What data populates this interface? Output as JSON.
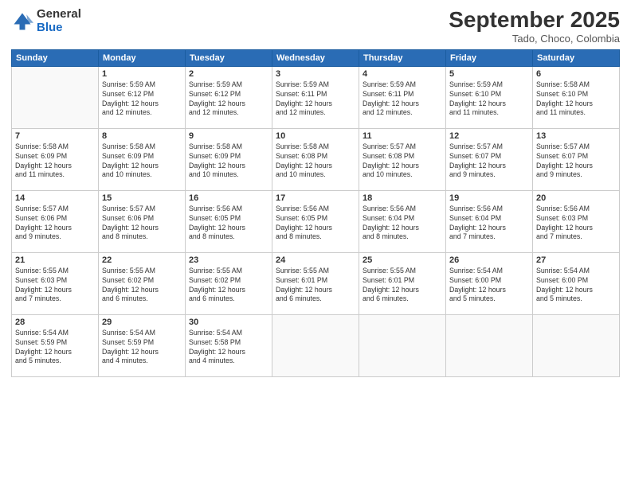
{
  "header": {
    "logo_general": "General",
    "logo_blue": "Blue",
    "month_title": "September 2025",
    "location": "Tado, Choco, Colombia"
  },
  "days_of_week": [
    "Sunday",
    "Monday",
    "Tuesday",
    "Wednesday",
    "Thursday",
    "Friday",
    "Saturday"
  ],
  "weeks": [
    [
      {
        "day": "",
        "info": ""
      },
      {
        "day": "1",
        "info": "Sunrise: 5:59 AM\nSunset: 6:12 PM\nDaylight: 12 hours\nand 12 minutes."
      },
      {
        "day": "2",
        "info": "Sunrise: 5:59 AM\nSunset: 6:12 PM\nDaylight: 12 hours\nand 12 minutes."
      },
      {
        "day": "3",
        "info": "Sunrise: 5:59 AM\nSunset: 6:11 PM\nDaylight: 12 hours\nand 12 minutes."
      },
      {
        "day": "4",
        "info": "Sunrise: 5:59 AM\nSunset: 6:11 PM\nDaylight: 12 hours\nand 12 minutes."
      },
      {
        "day": "5",
        "info": "Sunrise: 5:59 AM\nSunset: 6:10 PM\nDaylight: 12 hours\nand 11 minutes."
      },
      {
        "day": "6",
        "info": "Sunrise: 5:58 AM\nSunset: 6:10 PM\nDaylight: 12 hours\nand 11 minutes."
      }
    ],
    [
      {
        "day": "7",
        "info": "Sunrise: 5:58 AM\nSunset: 6:09 PM\nDaylight: 12 hours\nand 11 minutes."
      },
      {
        "day": "8",
        "info": "Sunrise: 5:58 AM\nSunset: 6:09 PM\nDaylight: 12 hours\nand 10 minutes."
      },
      {
        "day": "9",
        "info": "Sunrise: 5:58 AM\nSunset: 6:09 PM\nDaylight: 12 hours\nand 10 minutes."
      },
      {
        "day": "10",
        "info": "Sunrise: 5:58 AM\nSunset: 6:08 PM\nDaylight: 12 hours\nand 10 minutes."
      },
      {
        "day": "11",
        "info": "Sunrise: 5:57 AM\nSunset: 6:08 PM\nDaylight: 12 hours\nand 10 minutes."
      },
      {
        "day": "12",
        "info": "Sunrise: 5:57 AM\nSunset: 6:07 PM\nDaylight: 12 hours\nand 9 minutes."
      },
      {
        "day": "13",
        "info": "Sunrise: 5:57 AM\nSunset: 6:07 PM\nDaylight: 12 hours\nand 9 minutes."
      }
    ],
    [
      {
        "day": "14",
        "info": "Sunrise: 5:57 AM\nSunset: 6:06 PM\nDaylight: 12 hours\nand 9 minutes."
      },
      {
        "day": "15",
        "info": "Sunrise: 5:57 AM\nSunset: 6:06 PM\nDaylight: 12 hours\nand 8 minutes."
      },
      {
        "day": "16",
        "info": "Sunrise: 5:56 AM\nSunset: 6:05 PM\nDaylight: 12 hours\nand 8 minutes."
      },
      {
        "day": "17",
        "info": "Sunrise: 5:56 AM\nSunset: 6:05 PM\nDaylight: 12 hours\nand 8 minutes."
      },
      {
        "day": "18",
        "info": "Sunrise: 5:56 AM\nSunset: 6:04 PM\nDaylight: 12 hours\nand 8 minutes."
      },
      {
        "day": "19",
        "info": "Sunrise: 5:56 AM\nSunset: 6:04 PM\nDaylight: 12 hours\nand 7 minutes."
      },
      {
        "day": "20",
        "info": "Sunrise: 5:56 AM\nSunset: 6:03 PM\nDaylight: 12 hours\nand 7 minutes."
      }
    ],
    [
      {
        "day": "21",
        "info": "Sunrise: 5:55 AM\nSunset: 6:03 PM\nDaylight: 12 hours\nand 7 minutes."
      },
      {
        "day": "22",
        "info": "Sunrise: 5:55 AM\nSunset: 6:02 PM\nDaylight: 12 hours\nand 6 minutes."
      },
      {
        "day": "23",
        "info": "Sunrise: 5:55 AM\nSunset: 6:02 PM\nDaylight: 12 hours\nand 6 minutes."
      },
      {
        "day": "24",
        "info": "Sunrise: 5:55 AM\nSunset: 6:01 PM\nDaylight: 12 hours\nand 6 minutes."
      },
      {
        "day": "25",
        "info": "Sunrise: 5:55 AM\nSunset: 6:01 PM\nDaylight: 12 hours\nand 6 minutes."
      },
      {
        "day": "26",
        "info": "Sunrise: 5:54 AM\nSunset: 6:00 PM\nDaylight: 12 hours\nand 5 minutes."
      },
      {
        "day": "27",
        "info": "Sunrise: 5:54 AM\nSunset: 6:00 PM\nDaylight: 12 hours\nand 5 minutes."
      }
    ],
    [
      {
        "day": "28",
        "info": "Sunrise: 5:54 AM\nSunset: 5:59 PM\nDaylight: 12 hours\nand 5 minutes."
      },
      {
        "day": "29",
        "info": "Sunrise: 5:54 AM\nSunset: 5:59 PM\nDaylight: 12 hours\nand 4 minutes."
      },
      {
        "day": "30",
        "info": "Sunrise: 5:54 AM\nSunset: 5:58 PM\nDaylight: 12 hours\nand 4 minutes."
      },
      {
        "day": "",
        "info": ""
      },
      {
        "day": "",
        "info": ""
      },
      {
        "day": "",
        "info": ""
      },
      {
        "day": "",
        "info": ""
      }
    ]
  ]
}
